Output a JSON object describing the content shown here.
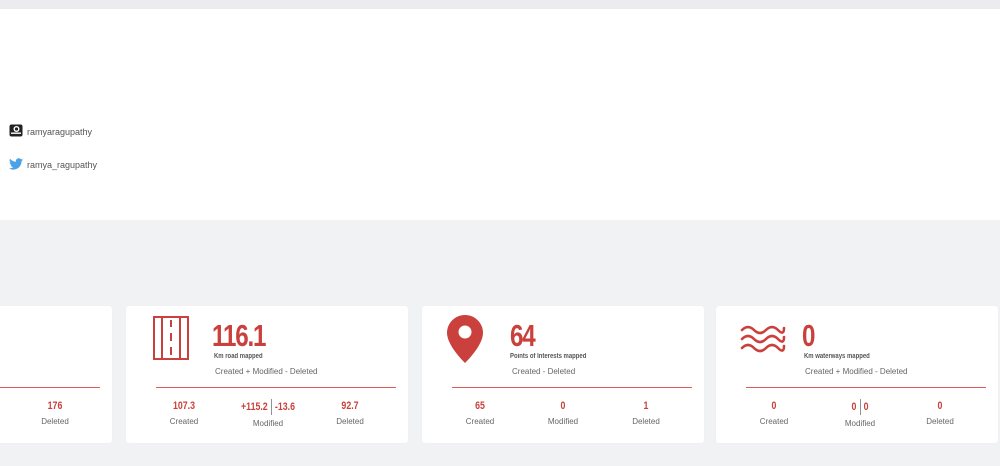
{
  "profile": {
    "osm_username": "ramyaragupathy",
    "twitter_handle": "ramya_ragupathy"
  },
  "cards": {
    "partial": {
      "deleted_value": "176",
      "deleted_label": "Deleted"
    },
    "roads": {
      "icon": "road-icon",
      "value": "116.1",
      "caption": "Km road mapped",
      "subtitle": "Created + Modified - Deleted",
      "created_value": "107.3",
      "created_label": "Created",
      "modified_plus": "+115.2",
      "modified_minus": "-13.6",
      "modified_label": "Modified",
      "deleted_value": "92.7",
      "deleted_label": "Deleted"
    },
    "poi": {
      "icon": "map-pin-icon",
      "value": "64",
      "caption": "Points of Interests mapped",
      "subtitle": "Created - Deleted",
      "created_value": "65",
      "created_label": "Created",
      "modified_value": "0",
      "modified_label": "Modified",
      "deleted_value": "1",
      "deleted_label": "Deleted"
    },
    "waterways": {
      "icon": "waves-icon",
      "value": "0",
      "caption": "Km waterways mapped",
      "subtitle": "Created + Modified - Deleted",
      "created_value": "0",
      "created_label": "Created",
      "modified_plus": "0",
      "modified_minus": "0",
      "modified_label": "Modified",
      "deleted_value": "0",
      "deleted_label": "Deleted"
    }
  },
  "colors": {
    "accent": "#c9403c",
    "divider": "#e05a57",
    "twitter": "#4aa3e8",
    "background": "#f1f2f4"
  }
}
